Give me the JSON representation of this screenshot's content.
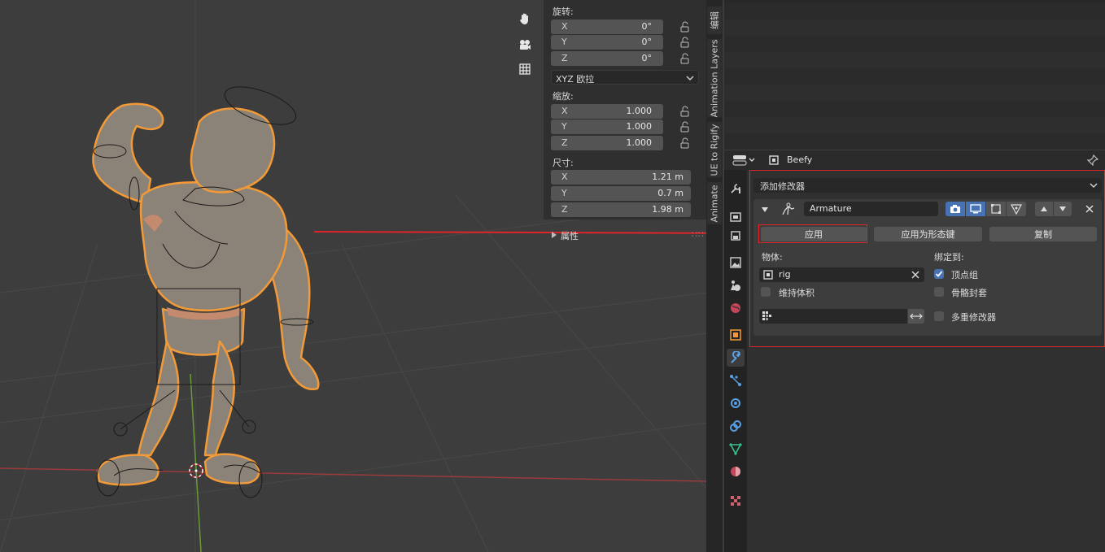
{
  "npanel": {
    "rotation_label": "旋转:",
    "rotation": [
      {
        "axis": "X",
        "value": "0°"
      },
      {
        "axis": "Y",
        "value": "0°"
      },
      {
        "axis": "Z",
        "value": "0°"
      }
    ],
    "rotation_mode": "XYZ 欧拉",
    "scale_label": "缩放:",
    "scale": [
      {
        "axis": "X",
        "value": "1.000"
      },
      {
        "axis": "Y",
        "value": "1.000"
      },
      {
        "axis": "Z",
        "value": "1.000"
      }
    ],
    "dimensions_label": "尺寸:",
    "dimensions": [
      {
        "axis": "X",
        "value": "1.21 m"
      },
      {
        "axis": "Y",
        "value": "0.7 m"
      },
      {
        "axis": "Z",
        "value": "1.98 m"
      }
    ],
    "properties_label": "属性"
  },
  "vertical_tabs": [
    "编辑",
    "Animation Layers",
    "UE to Rigify",
    "Animate"
  ],
  "properties": {
    "object_name": "Beefy",
    "add_modifier": "添加修改器",
    "modifier_name": "Armature",
    "apply_button": "应用",
    "apply_shape_button": "应用为形态键",
    "copy_button": "复制",
    "object_label": "物体:",
    "object_value": "rig",
    "bind_to_label": "绑定到:",
    "vertex_groups_label": "顶点组",
    "vertex_groups_checked": true,
    "preserve_volume_label": "维持体积",
    "preserve_volume_checked": false,
    "bone_envelopes_label": "骨骼封套",
    "bone_envelopes_checked": false,
    "multi_modifier_label": "多重修改器",
    "multi_modifier_checked": false,
    "vertex_group_value": ""
  },
  "colors": {
    "highlight_red": "#e0242a",
    "selection_orange": "#f29a38",
    "active_blue": "#4772b3"
  }
}
